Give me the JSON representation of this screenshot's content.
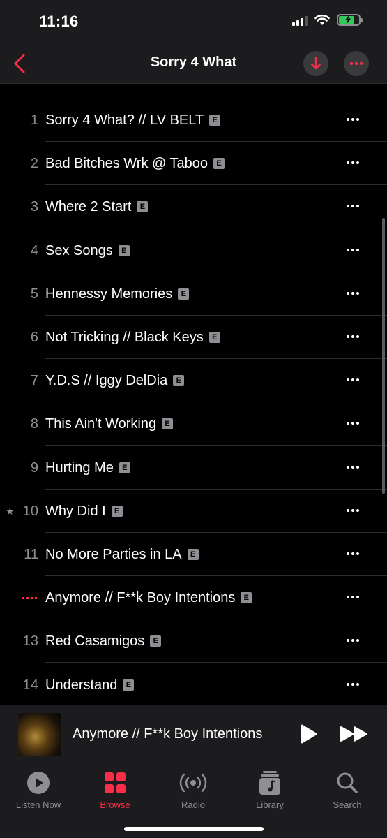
{
  "status": {
    "time": "11:16",
    "battery_level": 0.8,
    "battery_color": "#34c759"
  },
  "nav": {
    "title": "Sorry 4 What",
    "accent": "#fa2d48"
  },
  "tracks": [
    {
      "num": "1",
      "title": "Sorry 4 What? // LV BELT",
      "explicit": "E"
    },
    {
      "num": "2",
      "title": "Bad Bitches Wrk @ Taboo",
      "explicit": "E"
    },
    {
      "num": "3",
      "title": "Where 2 Start",
      "explicit": "E"
    },
    {
      "num": "4",
      "title": "Sex Songs",
      "explicit": "E"
    },
    {
      "num": "5",
      "title": "Hennessy Memories",
      "explicit": "E"
    },
    {
      "num": "6",
      "title": "Not Tricking // Black Keys",
      "explicit": "E"
    },
    {
      "num": "7",
      "title": "Y.D.S // Iggy DelDia",
      "explicit": "E"
    },
    {
      "num": "8",
      "title": "This Ain't Working",
      "explicit": "E"
    },
    {
      "num": "9",
      "title": "Hurting Me",
      "explicit": "E"
    },
    {
      "num": "10",
      "title": "Why Did I",
      "explicit": "E",
      "starred": true
    },
    {
      "num": "11",
      "title": "No More Parties in LA",
      "explicit": "E"
    },
    {
      "num": "",
      "title": "Anymore // F**k Boy Intentions",
      "explicit": "E",
      "playing": true
    },
    {
      "num": "13",
      "title": "Red Casamigos",
      "explicit": "E"
    },
    {
      "num": "14",
      "title": "Understand",
      "explicit": "E"
    }
  ],
  "now_playing": {
    "title": "Anymore // F**k Boy Intentions"
  },
  "tabs": [
    {
      "label": "Listen Now",
      "icon": "play-circle-icon",
      "active": false
    },
    {
      "label": "Browse",
      "icon": "browse-grid-icon",
      "active": true
    },
    {
      "label": "Radio",
      "icon": "radio-icon",
      "active": false
    },
    {
      "label": "Library",
      "icon": "library-icon",
      "active": false
    },
    {
      "label": "Search",
      "icon": "search-icon",
      "active": false
    }
  ]
}
